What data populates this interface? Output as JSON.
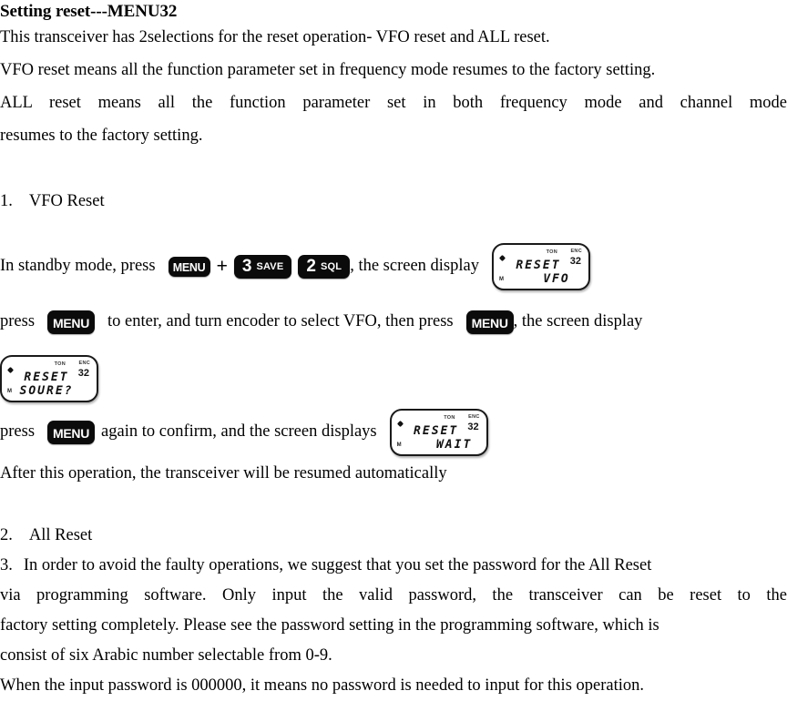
{
  "document": {
    "title": "Setting reset---MENU32",
    "intro": [
      "This transceiver has 2selections for the reset operation- VFO reset and ALL reset.",
      "VFO reset means all the function parameter set in frequency mode resumes to the factory setting.",
      "ALL reset means all the function parameter set in both frequency mode and channel mode",
      "resumes to the factory setting."
    ],
    "section_vfo": {
      "number": "1.",
      "heading": "VFO Reset",
      "step1_pre": "In standby mode, press",
      "step1_post": ",   the screen display",
      "step2_pre": "press",
      "step2_mid": "to enter, and turn encoder to select VFO, then press",
      "step2_post": ",  the screen  display",
      "step3_pre": "press",
      "step3_mid": "again to confirm, and the screen displays",
      "closing": "After this operation, the transceiver will be resumed automatically"
    },
    "section_all": {
      "item2_number": "2.",
      "item2_text": "All Reset",
      "item3_number": "3.",
      "item3_text": "In order to avoid the faulty operations, we suggest that you set the password for the All Reset",
      "body": [
        "via programming software. Only input the valid password, the transceiver can be reset to the",
        "factory setting completely. Please see the password setting in the programming software, which is",
        "consist of six Arabic number selectable from 0-9.",
        "When the input password is 000000, it means no password is needed to input for this operation."
      ]
    }
  },
  "keys": {
    "menu": "MENU",
    "plus": "+",
    "key3": {
      "digit": "3",
      "sub": "SAVE"
    },
    "key2": {
      "digit": "2",
      "sub": "SQL"
    }
  },
  "lcds": {
    "reset_vfo": {
      "line1": "RESET",
      "line2": "VFO",
      "tag_tone": "TON",
      "tag_enc": "ENC",
      "menu_number": "32",
      "side_mark": "M"
    },
    "reset_source": {
      "line1": "RESET",
      "line2": "SOURE?",
      "tag_tone": "TON",
      "tag_enc": "ENC",
      "menu_number": "32",
      "side_mark": "M"
    },
    "reset_wait": {
      "line1": "RESET",
      "line2": "WAIT",
      "tag_tone": "TON",
      "tag_enc": "ENC",
      "menu_number": "32",
      "side_mark": "M"
    }
  },
  "colors": {
    "key_background": "#0b0b0b",
    "key_text": "#ffffff",
    "text": "#000000",
    "page_background": "#ffffff"
  }
}
